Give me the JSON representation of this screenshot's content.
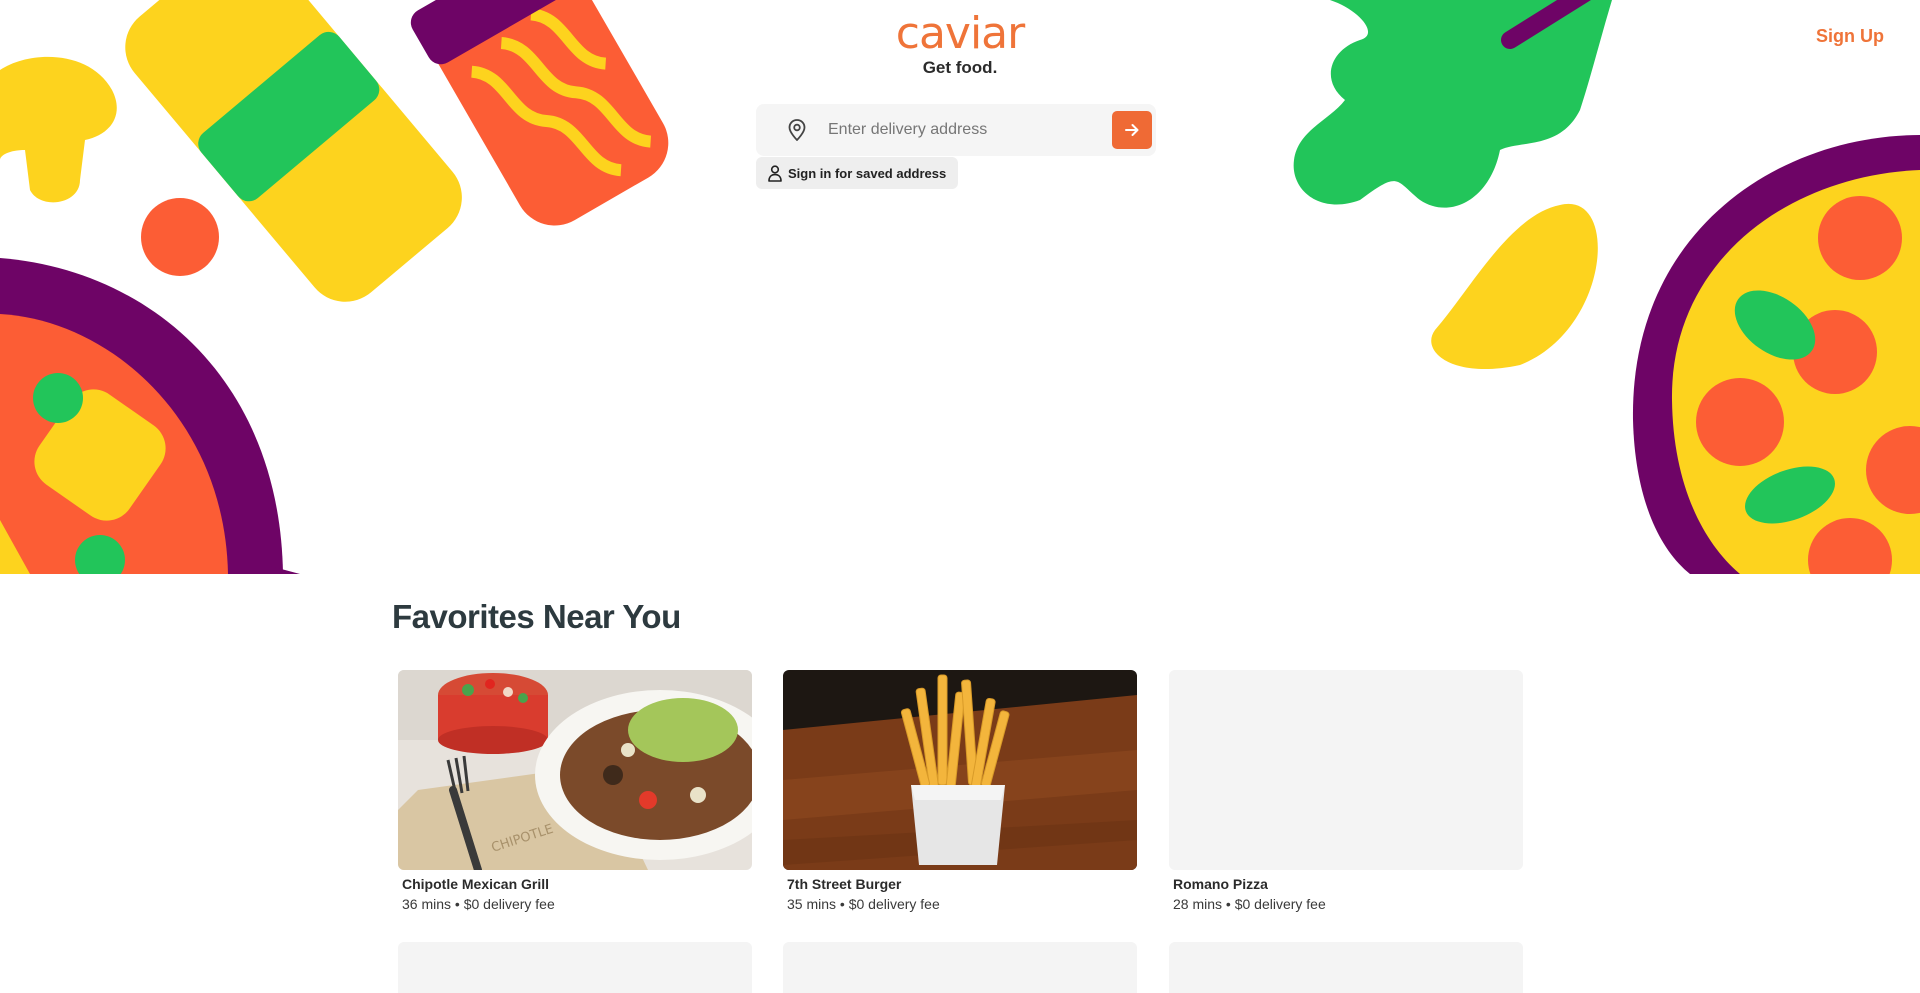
{
  "header": {
    "logo": "caviar",
    "tagline": "Get food.",
    "signup_label": "Sign Up"
  },
  "search": {
    "placeholder": "Enter delivery address",
    "value": "",
    "saved_address_label": "Sign in for saved address"
  },
  "favorites": {
    "title": "Favorites Near You",
    "restaurants": [
      {
        "name": "Chipotle Mexican Grill",
        "meta": "36 mins • $0 delivery fee",
        "image": "burrito-bowl-photo"
      },
      {
        "name": "7th Street Burger",
        "meta": "35 mins • $0 delivery fee",
        "image": "fries-photo"
      },
      {
        "name": "Romano Pizza",
        "meta": "28 mins • $0 delivery fee",
        "image": "placeholder"
      }
    ]
  },
  "colors": {
    "brand_orange": "#ef7439",
    "button_orange": "#ef6a35",
    "yellow": "#fdd31e",
    "green": "#22c55a",
    "purple": "#6e0466",
    "red_orange": "#fc5d35"
  },
  "icons": [
    "location-pin-icon",
    "arrow-right-icon",
    "person-icon"
  ]
}
